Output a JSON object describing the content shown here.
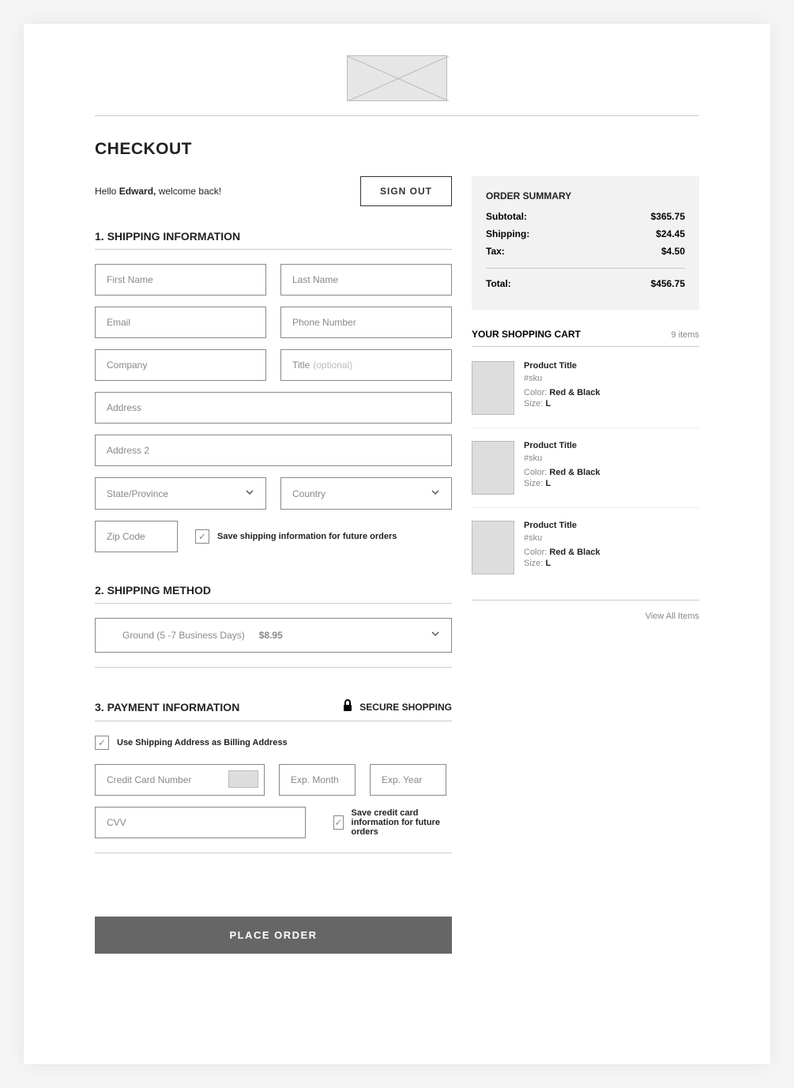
{
  "page_title": "CHECKOUT",
  "greeting": {
    "hello": "Hello ",
    "name": "Edward,",
    "welcome": " welcome back!"
  },
  "signout": "SIGN OUT",
  "sections": {
    "shipping_info": "1. SHIPPING INFORMATION",
    "shipping_method": "2. SHIPPING METHOD",
    "payment_info": "3. PAYMENT INFORMATION"
  },
  "secure_shopping": "SECURE SHOPPING",
  "fields": {
    "first_name": "First Name",
    "last_name": "Last Name",
    "email": "Email",
    "phone": "Phone Number",
    "company": "Company",
    "title_label": "Title",
    "title_opt": "(optional)",
    "address": "Address",
    "address2": "Address 2",
    "state": "State/Province",
    "country": "Country",
    "zip": "Zip Code",
    "cc_number": "Credit Card Number",
    "exp_month": "Exp. Month",
    "exp_year": "Exp. Year",
    "cvv": "CVV"
  },
  "checks": {
    "save_shipping": "Save shipping information for future orders",
    "use_shipping_billing": "Use Shipping Address as Billing Address",
    "save_cc": "Save credit card information for future orders"
  },
  "ship_method": {
    "label": "Ground (5 -7 Business Days)",
    "price": "$8.95"
  },
  "place_order": "PLACE ORDER",
  "summary": {
    "title": "ORDER SUMMARY",
    "subtotal_label": "Subtotal:",
    "subtotal": "$365.75",
    "shipping_label": "Shipping:",
    "shipping": "$24.45",
    "tax_label": "Tax:",
    "tax": "$4.50",
    "total_label": "Total:",
    "total": "$456.75"
  },
  "cart": {
    "title": "YOUR SHOPPING CART",
    "count": "9 items",
    "view_all": "View All Items",
    "items": [
      {
        "title": "Product Title",
        "sku": "#sku",
        "color_label": "Color: ",
        "color": "Red & Black",
        "size_label": "Size: ",
        "size": "L"
      },
      {
        "title": "Product Title",
        "sku": "#sku",
        "color_label": "Color: ",
        "color": "Red & Black",
        "size_label": "Size: ",
        "size": "L"
      },
      {
        "title": "Product Title",
        "sku": "#sku",
        "color_label": "Color: ",
        "color": "Red & Black",
        "size_label": "Size: ",
        "size": "L"
      }
    ]
  }
}
